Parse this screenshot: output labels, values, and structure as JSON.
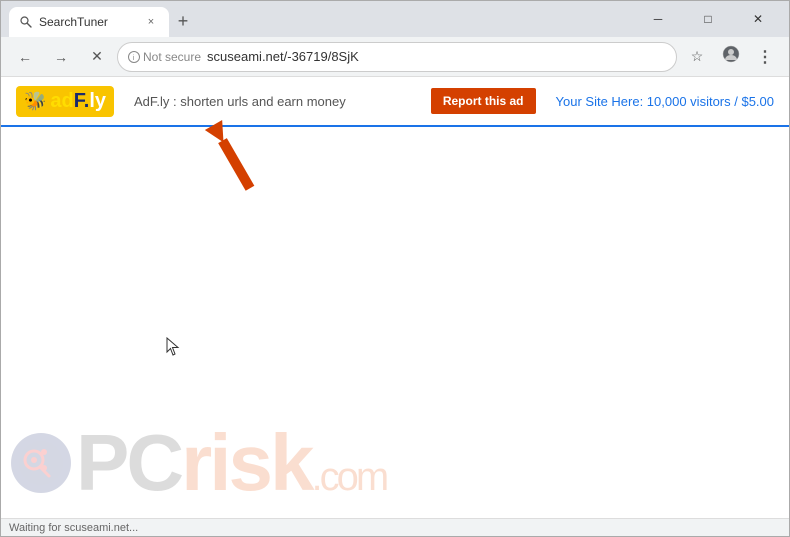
{
  "window": {
    "title": "SearchTuner",
    "tab": {
      "label": "SearchTuner",
      "close_icon": "×"
    },
    "new_tab_icon": "+",
    "controls": {
      "minimize": "─",
      "maximize": "□",
      "close": "✕"
    }
  },
  "toolbar": {
    "back_icon": "←",
    "forward_icon": "→",
    "reload_icon": "✕",
    "security_label": "Not secure",
    "url": "scuseami.net/-36719/8SjK",
    "bookmark_icon": "☆",
    "profile_icon": "⊙",
    "menu_icon": "⋮"
  },
  "ad_bar": {
    "logo_text": "adf.ly",
    "tagline": "AdF.ly : shorten urls and earn money",
    "report_btn": "Report this ad",
    "offer": "Your Site Here: 10,000 visitors / $5.00"
  },
  "watermark": {
    "text": "PC",
    "risk": "risk",
    "com": ".com"
  },
  "status_bar": {
    "text": "Waiting for scuseami.net..."
  },
  "colors": {
    "accent_blue": "#1a73e8",
    "report_red": "#d44000",
    "logo_yellow": "#f9c400"
  }
}
